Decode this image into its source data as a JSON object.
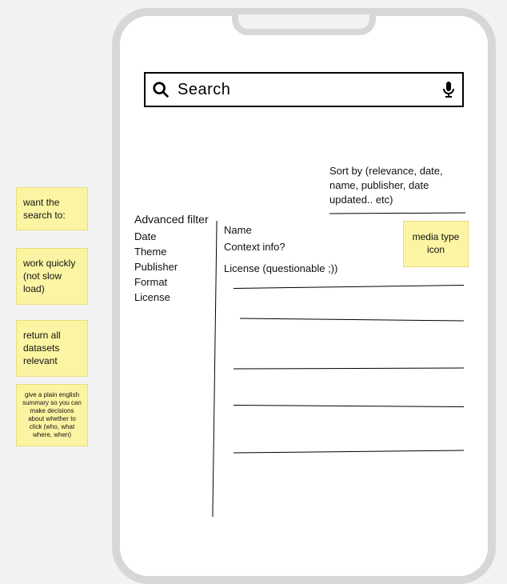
{
  "search": {
    "placeholder": "Search"
  },
  "sort": {
    "label": "Sort by (relevance, date, name, publisher, date updated.. etc)"
  },
  "advanced_filter": {
    "title": "Advanced filter",
    "items": [
      "Date",
      "Theme",
      "Publisher",
      "Format",
      "License"
    ]
  },
  "result_card": {
    "name": "Name",
    "context": "Context info?",
    "license": "License (questionable ;))"
  },
  "media_note": "media type icon",
  "sticky_notes": {
    "heading": "want the search to:",
    "items": [
      "work quickly (not slow load)",
      "return all datasets relevant",
      "give a plain english summary so you can make decisions about whether to click (who, what where, when)"
    ]
  }
}
